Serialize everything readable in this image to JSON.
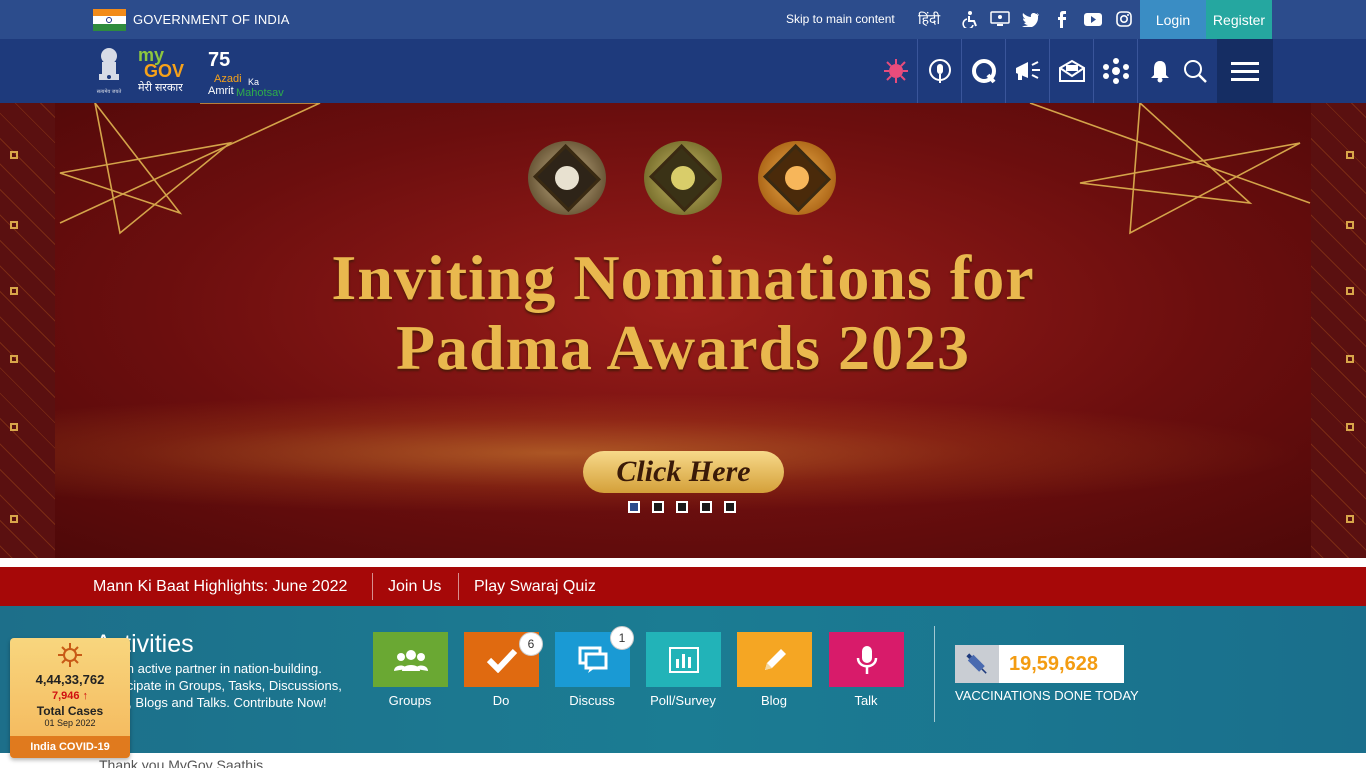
{
  "gov_bar": {
    "title": "GOVERNMENT OF INDIA",
    "skip_link": "Skip to main content",
    "hindi": "हिंदी",
    "icons": [
      "accessibility-icon",
      "sitemap-icon",
      "twitter-icon",
      "facebook-icon",
      "youtube-icon",
      "instagram-icon"
    ],
    "login": "Login",
    "register": "Register",
    "colors": {
      "bar": "#2c4c8c",
      "login": "#3a8dc4",
      "register": "#25a7a0"
    }
  },
  "header": {
    "emblem_caption": "सत्यमेव जयते",
    "mygov_my": "my",
    "mygov_gov": "GOV",
    "mygov_sarkar": "मेरी सरकार",
    "azadi_75": "75",
    "azadi_word": "Azadi",
    "azadi_ka": "Ka",
    "azadi_amrit": "Amrit",
    "azadi_mahotsav": "Mahotsav",
    "icons": [
      "covid-virus-icon",
      "podcast-icon",
      "quiz-icon",
      "campaign-icon",
      "newsletter-icon",
      "apps-icon",
      "notification-bell-icon",
      "search-icon",
      "menu-icon"
    ]
  },
  "banner": {
    "title_line1": "Inviting Nominations for",
    "title_line2": "Padma Awards 2023",
    "cta": "Click Here",
    "slides": 5,
    "active_slide": 1
  },
  "link_bar": {
    "items": [
      "Mann Ki Baat Highlights: June 2022",
      "Join Us",
      "Play Swaraj Quiz"
    ]
  },
  "activities": {
    "title": "Activities",
    "description": "Be an active partner in nation-building. Participate in Groups, Tasks, Discussions, Polls, Blogs and Talks. Contribute Now!",
    "tiles": [
      {
        "label": "Groups",
        "icon": "groups-icon",
        "color": "#6aa833",
        "badge": ""
      },
      {
        "label": "Do",
        "icon": "check-icon",
        "color": "#e06a10",
        "badge": "6"
      },
      {
        "label": "Discuss",
        "icon": "discuss-icon",
        "color": "#1a9ad4",
        "badge": "1"
      },
      {
        "label": "Poll/Survey",
        "icon": "poll-icon",
        "color": "#22b3b8",
        "badge": ""
      },
      {
        "label": "Blog",
        "icon": "pencil-icon",
        "color": "#f5a623",
        "badge": ""
      },
      {
        "label": "Talk",
        "icon": "microphone-icon",
        "color": "#d81b6a",
        "badge": ""
      }
    ],
    "vaccinations_count": "19,59,628",
    "vaccinations_label": "VACCINATIONS DONE TODAY"
  },
  "bottom_text": "Thank you MyGov Saathis",
  "covid": {
    "total": "4,44,33,762",
    "new": "7,946",
    "label": "Total Cases",
    "date": "01 Sep 2022",
    "footer": "India COVID-19"
  }
}
